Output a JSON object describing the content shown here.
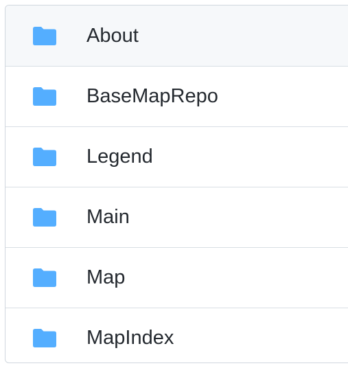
{
  "colors": {
    "folder_icon": "#54aeff",
    "text": "#24292f",
    "border": "#d0d7de",
    "first_row_background": "#f6f8fa"
  },
  "file_list": {
    "items": [
      {
        "label": "About",
        "icon": "folder-icon",
        "type": "directory"
      },
      {
        "label": "BaseMapRepo",
        "icon": "folder-icon",
        "type": "directory"
      },
      {
        "label": "Legend",
        "icon": "folder-icon",
        "type": "directory"
      },
      {
        "label": "Main",
        "icon": "folder-icon",
        "type": "directory"
      },
      {
        "label": "Map",
        "icon": "folder-icon",
        "type": "directory"
      },
      {
        "label": "MapIndex",
        "icon": "folder-icon",
        "type": "directory"
      }
    ]
  }
}
